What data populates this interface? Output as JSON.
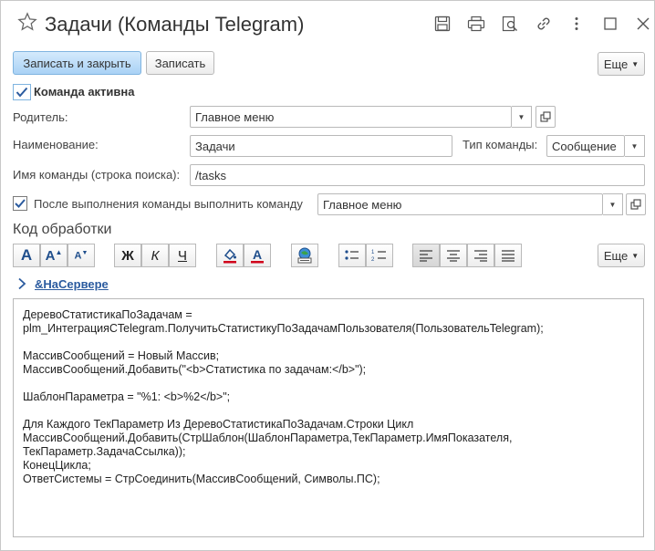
{
  "window": {
    "title": "Задачи (Команды Telegram)"
  },
  "toolbar": {
    "save_close_label": "Записать и закрыть",
    "save_label": "Записать",
    "more_label": "Еще"
  },
  "form": {
    "active_checkbox_label": "Команда активна",
    "parent_label": "Родитель:",
    "parent_value": "Главное меню",
    "name_label": "Наименование:",
    "name_value": "Задачи",
    "command_type_label": "Тип команды:",
    "command_type_value": "Сообщение",
    "command_name_label": "Имя команды (строка поиска):",
    "command_name_value": "/tasks",
    "after_exec_label": "После выполнения команды выполнить команду",
    "after_exec_value": "Главное меню"
  },
  "code_section": {
    "title": "Код обработки",
    "more_label": "Еще",
    "server_link": "&НаСервере",
    "lines": [
      "ДеревоСтатистикаПоЗадачам =",
      "plm_ИнтеграцияСTelegram.ПолучитьСтатистикуПоЗадачамПользователя(ПользовательTelegram);",
      "",
      "МассивСообщений = Новый Массив;",
      "МассивСообщений.Добавить(\"<b>Статистика по задачам:</b>\");",
      "",
      "ШаблонПараметра = \"%1: <b>%2</b>\";",
      "",
      "Для Каждого ТекПараметр Из ДеревоСтатистикаПоЗадачам.Строки Цикл",
      "МассивСообщений.Добавить(СтрШаблон(ШаблонПараметра,ТекПараметр.ИмяПоказателя,",
      "ТекПараметр.ЗадачаСсылка));",
      "КонецЦикла;",
      "ОтветСистемы = СтрСоединить(МассивСообщений, Символы.ПС);"
    ]
  },
  "format_buttons": {
    "bold": "Ж",
    "italic": "К",
    "underline": "Ч"
  },
  "colors": {
    "primary_button": "#a9d2f5",
    "link": "#2b5b9f",
    "red_accent": "#d0021b",
    "check": "#2b5b9f"
  }
}
